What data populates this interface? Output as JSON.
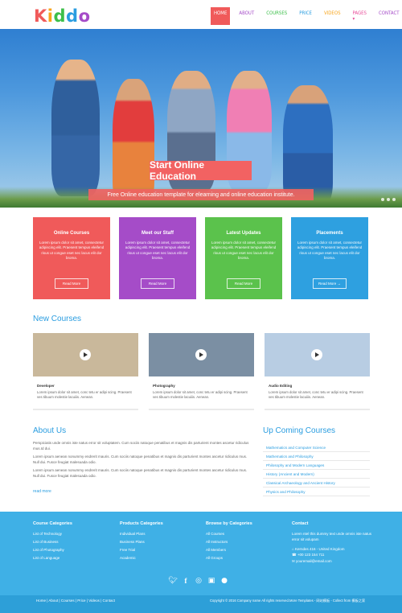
{
  "logo": {
    "letters": [
      "K",
      "i",
      "d",
      "d",
      "o"
    ],
    "colors": [
      "#f05a5a",
      "#f8a51b",
      "#3cbf4a",
      "#2a9de0",
      "#a54cc8"
    ]
  },
  "nav": [
    {
      "label": "HOME",
      "color": "#ffffff",
      "active": true
    },
    {
      "label": "ABOUT",
      "color": "#a54cc8"
    },
    {
      "label": "COURSES",
      "color": "#3cbf4a"
    },
    {
      "label": "PRICE",
      "color": "#2a9de0"
    },
    {
      "label": "VIDEOS",
      "color": "#f8a51b"
    },
    {
      "label": "PAGES ▾",
      "color": "#e84e9b"
    },
    {
      "label": "CONTACT",
      "color": "#a54cc8"
    }
  ],
  "hero": {
    "title": "Start Online Education",
    "subtitle": "Free Online education template for elearning and online education institute."
  },
  "features": [
    {
      "title": "Online Courses",
      "text": "Lorem ipsum dolor sit amet, consectetur adipiscing elit. Praesent tempus eleifend risus ut congue eset nec lacus elit dor broma.",
      "button": "Read More",
      "color": "#f05a5a"
    },
    {
      "title": "Meet our Staff",
      "text": "Lorem ipsum dolor sit amet, consectetur adipiscing elit. Praesent tempus eleifend risus ut congue eset nec lacus elit dor broma.",
      "button": "Read More",
      "color": "#a54cc8"
    },
    {
      "title": "Latest Updates",
      "text": "Lorem ipsum dolor sit amet, consectetur adipiscing elit. Praesent tempus eleifend risus ut congue eset nec lacus elit dor broma.",
      "button": "Read More",
      "color": "#5bc24c"
    },
    {
      "title": "Placements",
      "text": "Lorem ipsum dolor sit amet, consectetur adipiscing elit. Praesent tempus eleifend risus ut congue eset nec lacus elit dor broma.",
      "button": "Read More →",
      "color": "#2ea0e0"
    }
  ],
  "new_courses": {
    "title": "New Courses",
    "items": [
      {
        "name": "Developer",
        "text": "Lorem ipsum dolor sit amet, conc tetu er adipi scing. Praesent ves tibuum molestie lacuiiis. Aenean.",
        "thumb": "#c9b89b"
      },
      {
        "name": "Photography",
        "text": "Lorem ipsum dolor sit amet, conc tetu er adipi scing. Praesent ves tibuum molestie lacuiiis. Aenean.",
        "thumb": "#7b8fa3"
      },
      {
        "name": "Audio Editing",
        "text": "Lorem ipsum dolor sit amet, conc tetu er adipi scing. Praesent ves tibuum molestie lacuiiis. Aenean.",
        "thumb": "#b8cde3"
      }
    ]
  },
  "about": {
    "title": "About Us",
    "paragraphs": [
      "Perspiciatis unde omnis iste natus error sit voluptatem. Cum sociis natoque penatibus et magnis dis parturient montes ascetur ridiculus mus.Id dui.",
      "Lorem ipsum aenean nonummy endrerit mauris. Cum sociis natoque penatibus et magnis dis parturient montes ascetur ridiculus mus. Null dui. Fusce feugiat malesuada odio.",
      "Lorem ipsum aenean nonummy endrerit mauris. Cum sociis natoque penatibus et magnis dis parturient montes ascetur ridiculus mus. Null dui. Fusce feugiat malesuada odio."
    ],
    "read_more": "read more"
  },
  "upcoming": {
    "title": "Up Coming Courses",
    "items": [
      "Mathematics and Computer Science",
      "Mathematics and Philosophy",
      "Philosophy and Modern Languages",
      "History (Ancient and Modern)",
      "Classical Archaeology and Ancient History",
      "Physics and Philosophy"
    ]
  },
  "footer": {
    "course_categories": {
      "title": "Course Categories",
      "items": [
        "List of Technology",
        "List of Business",
        "List of Photography",
        "List of Language"
      ]
    },
    "products_categories": {
      "title": "Products Categories",
      "items": [
        "Individual Plans",
        "Business Plans",
        "Free Trial",
        "Academic"
      ]
    },
    "browse_categories": {
      "title": "Browse by Categories",
      "items": [
        "All Courses",
        "All Instructors",
        "All Members",
        "All Groups"
      ]
    },
    "contact": {
      "title": "Contact",
      "text": "Lorem ntel this dummy text unde omnis iste natus error sit volupam",
      "address": "Kerndes 416 - United Kingdom",
      "phone": "+00 123 154 711",
      "email": "youremail@email.com"
    },
    "social_icons": [
      "twitter-icon",
      "facebook-icon",
      "dribbble-icon",
      "flickr-icon",
      "github-icon"
    ]
  },
  "bottom": {
    "links": "Home   |   About   |   Courses   |   Price   |   Videos   |   Contact",
    "copyright": "Copyright © 2016 Company name All rights reserved.More Templates - 网站模板 - Collect from 模板之家"
  }
}
